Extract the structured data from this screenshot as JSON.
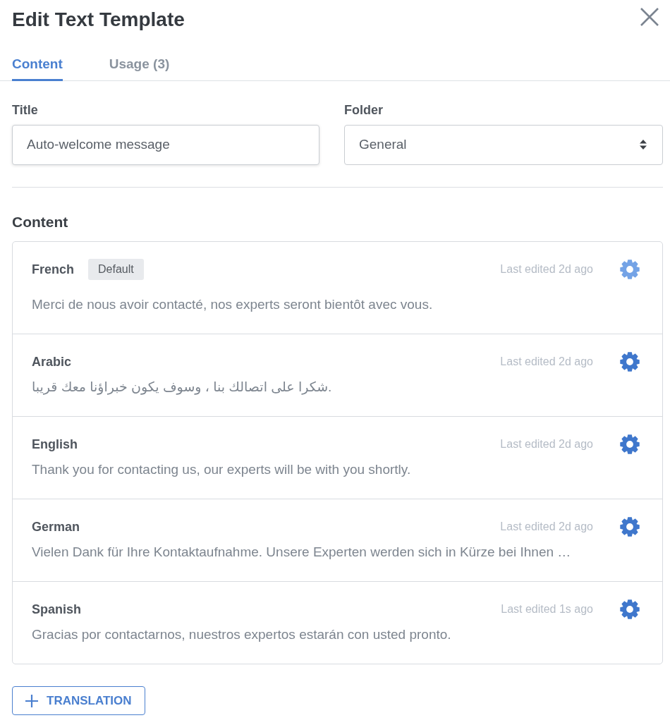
{
  "dialog": {
    "title": "Edit Text Template"
  },
  "tabs": [
    {
      "label": "Content",
      "selected": true
    },
    {
      "label": "Usage (3)",
      "selected": false
    }
  ],
  "form": {
    "title_field": {
      "label": "Title",
      "value": "Auto-welcome message"
    },
    "folder_field": {
      "label": "Folder",
      "value": "General"
    }
  },
  "content": {
    "heading": "Content",
    "translations": [
      {
        "language": "French",
        "badge": "Default",
        "last_edited": "Last edited 2d ago",
        "text": "Merci de nous avoir contacté, nos experts seront bientôt avec vous.",
        "hovered": true
      },
      {
        "language": "Arabic",
        "last_edited": "Last edited 2d ago",
        "text": "شكرا على اتصالك بنا ، وسوف يكون خبراؤنا معك قريبا.",
        "hovered": false
      },
      {
        "language": "English",
        "last_edited": "Last edited 2d ago",
        "text": "Thank you for contacting us, our experts will be with you shortly.",
        "hovered": false
      },
      {
        "language": "German",
        "last_edited": "Last edited 2d ago",
        "text": "Vielen Dank für Ihre Kontaktaufnahme. Unsere Experten werden sich in Kürze bei Ihnen …",
        "hovered": false
      },
      {
        "language": "Spanish",
        "last_edited": "Last edited 1s ago",
        "text": "Gracias por contactarnos, nuestros expertos estarán con usted pronto.",
        "hovered": false
      }
    ]
  },
  "add_button": {
    "label": "TRANSLATION"
  }
}
